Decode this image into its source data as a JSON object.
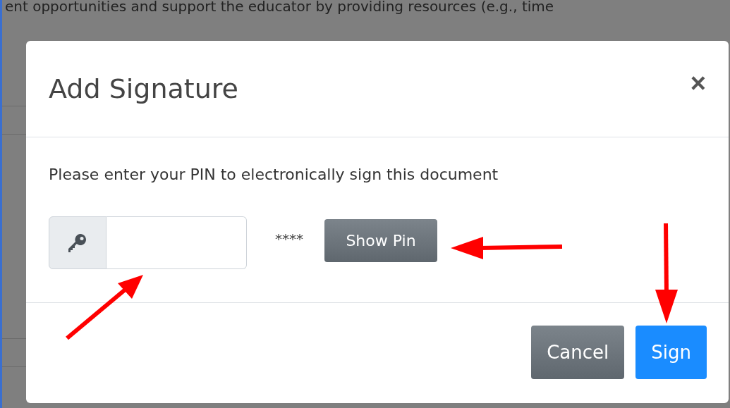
{
  "background_text": "ent opportunities and support the educator by providing resources (e.g., time",
  "dialog": {
    "title": "Add Signature",
    "close": "×",
    "message": "Please enter your PIN to electronically sign this document",
    "masked_pin": "****",
    "show_pin_button": {
      "label": "Show Pin",
      "kind": "secondary"
    },
    "buttons": [
      {
        "label": "Cancel",
        "kind": "secondary"
      },
      {
        "label": "Sign",
        "kind": "primary"
      }
    ]
  }
}
